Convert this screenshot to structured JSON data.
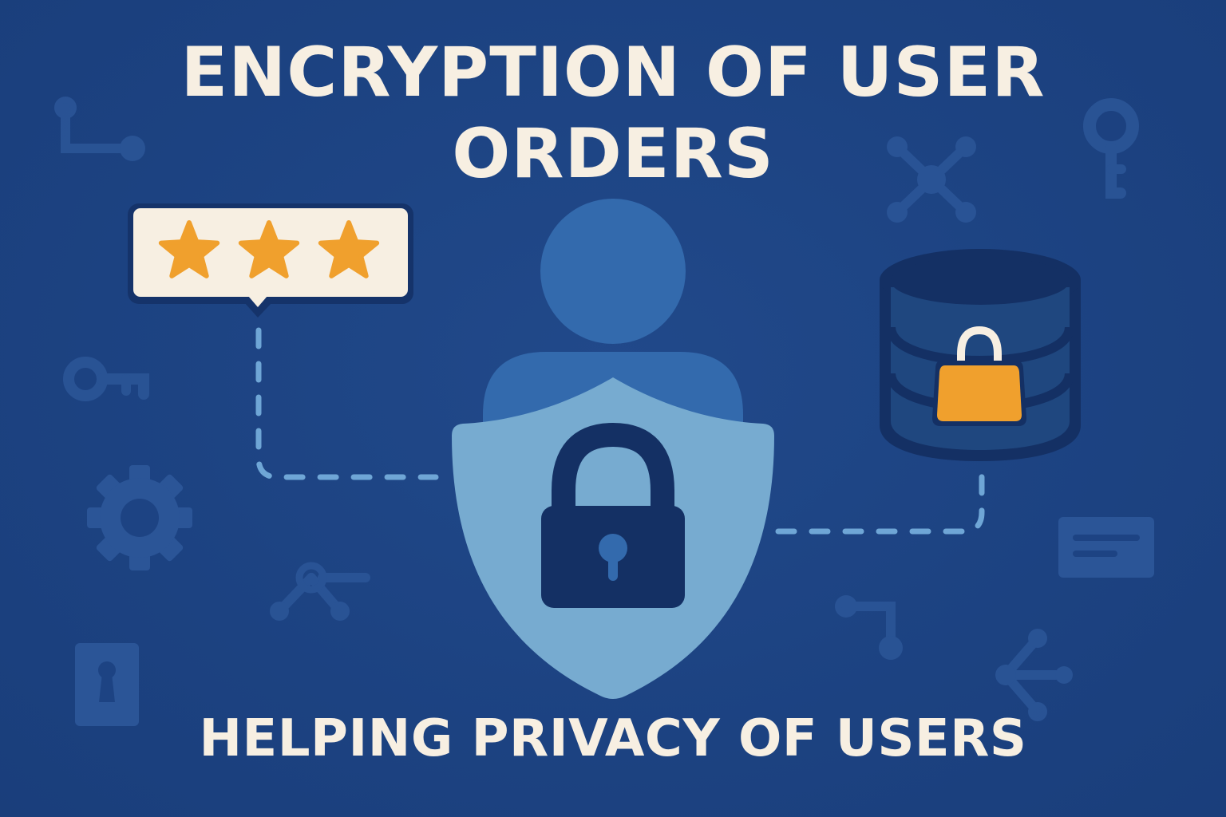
{
  "title": {
    "line1": "ENCRYPTION OF USER",
    "line2": "ORDERS"
  },
  "subtitle": "HELPING PRIVACY OF USERS",
  "rating": {
    "stars": 3
  },
  "colors": {
    "background": "#1d4383",
    "title_text": "#f7efe2",
    "star": "#f0a02d",
    "database_padlock": "#f0a02d",
    "shield": "#77abd0",
    "user_figure": "#336aad",
    "padlock": "#143064",
    "dashed_connector": "#6fa6d6"
  },
  "icons": {
    "main": [
      "user-icon",
      "shield-icon",
      "padlock-icon",
      "speech-bubble-icon",
      "star-icon",
      "database-icon"
    ],
    "background": [
      "key-icon",
      "gear-icon",
      "network-icon",
      "share-icon",
      "keyhole-icon",
      "credit-card-icon",
      "circuit-icon"
    ]
  }
}
